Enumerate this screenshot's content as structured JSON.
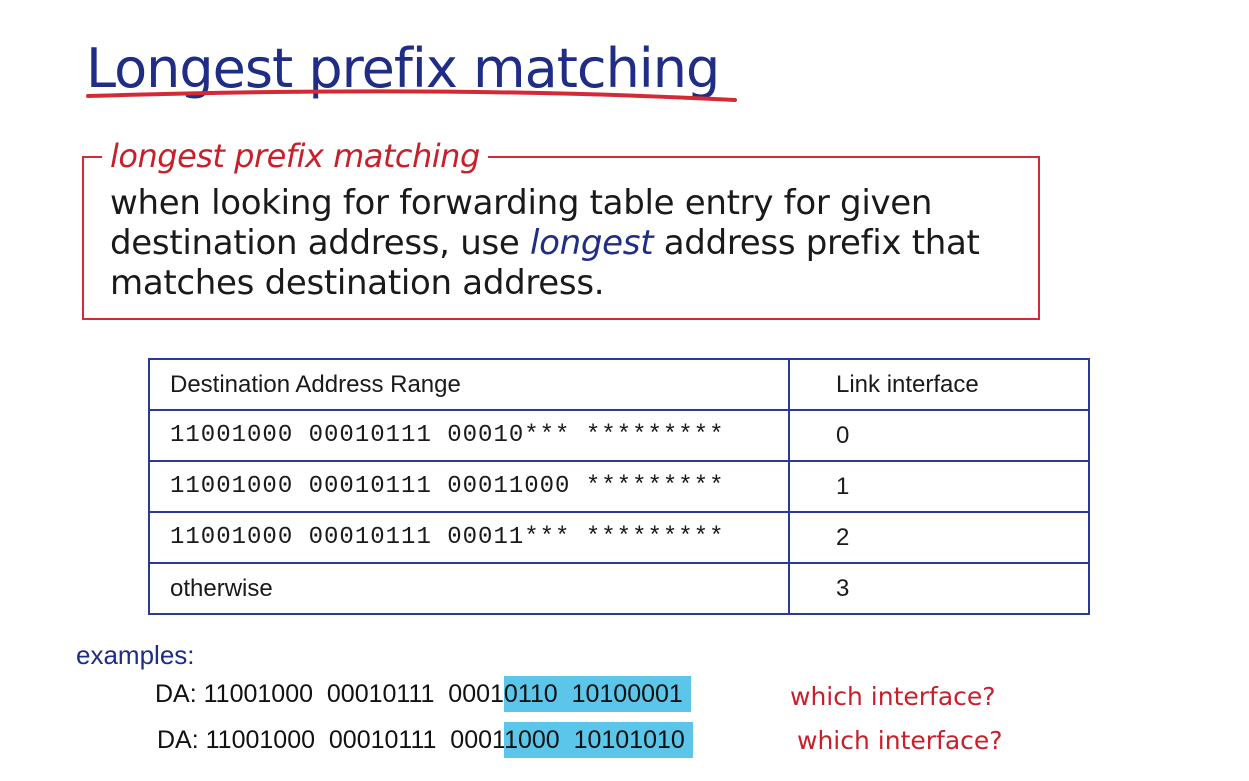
{
  "slide": {
    "title": "Longest prefix matching",
    "definition": {
      "label": "longest prefix matching",
      "text_before": "when looking for forwarding table entry for given destination address, use ",
      "emphasis": "longest",
      "text_after": " address prefix that matches destination address."
    },
    "table": {
      "headers": [
        "Destination Address Range",
        "Link interface"
      ],
      "rows": [
        {
          "range": "11001000 00010111 00010*** *********",
          "link": "0"
        },
        {
          "range": "11001000 00010111 00011000 *********",
          "link": "1"
        },
        {
          "range": "11001000 00010111 00011*** *********",
          "link": "2"
        },
        {
          "range": "otherwise",
          "link": "3"
        }
      ]
    },
    "examples": {
      "label": "examples:",
      "items": [
        {
          "prefix": "DA: 11001000  00010111  0001",
          "highlighted": "0110  10100001",
          "question": "which interface?"
        },
        {
          "prefix": "DA: 11001000  00010111  0001",
          "highlighted": "1000  10101010",
          "question": "which interface?"
        }
      ]
    },
    "colors": {
      "title": "#1f2d86",
      "accent_red": "#c8202b",
      "table_border": "#2b3a9a",
      "highlight": "#5bc6ea"
    }
  }
}
